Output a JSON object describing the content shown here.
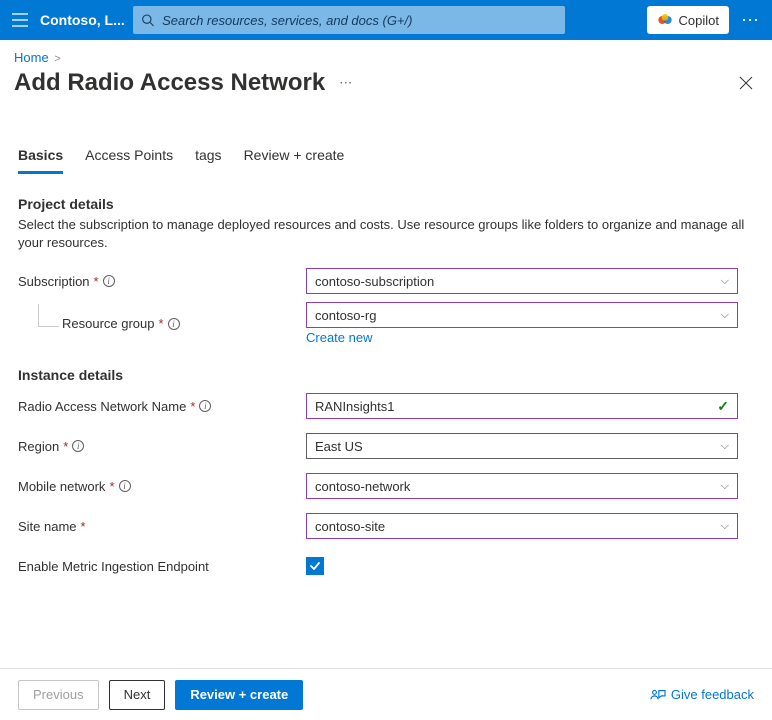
{
  "topbar": {
    "tenant": "Contoso, L...",
    "search_placeholder": "Search resources, services, and docs (G+/)",
    "copilot": "Copilot"
  },
  "breadcrumb": {
    "home": "Home"
  },
  "page": {
    "title": "Add Radio Access Network"
  },
  "tabs": {
    "basics": "Basics",
    "access_points": "Access Points",
    "tags": "tags",
    "review": "Review + create"
  },
  "sections": {
    "project_h": "Project details",
    "project_desc": "Select the subscription to manage deployed resources and costs. Use resource groups like folders to organize and manage all your resources.",
    "instance_h": "Instance details"
  },
  "fields": {
    "subscription": {
      "label": "Subscription",
      "value": "contoso-subscription"
    },
    "resource_group": {
      "label": "Resource group",
      "value": "contoso-rg",
      "create_new": "Create new"
    },
    "ran_name": {
      "label": "Radio Access Network Name",
      "value": "RANInsights1"
    },
    "region": {
      "label": "Region",
      "value": "East US"
    },
    "mobile_network": {
      "label": "Mobile network",
      "value": "contoso-network"
    },
    "site_name": {
      "label": "Site name",
      "value": "contoso-site"
    },
    "enable_metric": {
      "label": "Enable Metric Ingestion Endpoint",
      "checked": true
    }
  },
  "footer": {
    "previous": "Previous",
    "next": "Next",
    "review": "Review + create",
    "feedback": "Give feedback"
  }
}
